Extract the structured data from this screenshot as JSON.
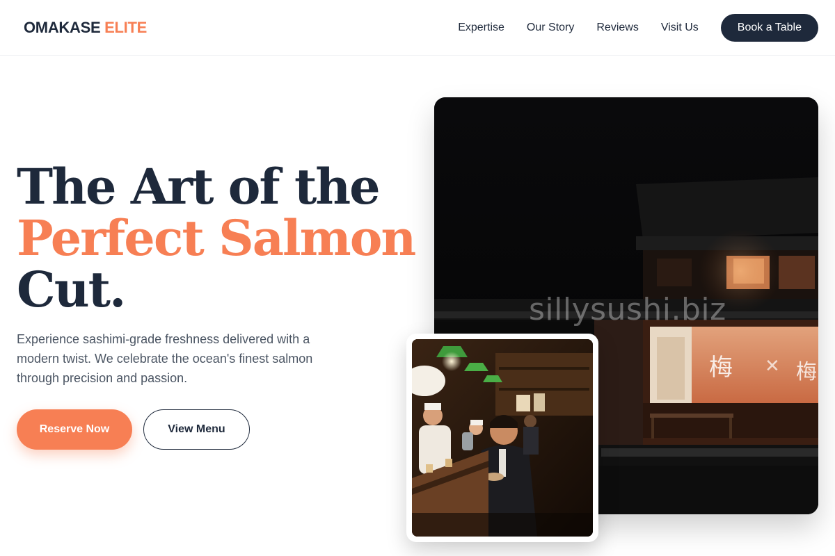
{
  "brand": {
    "part1": "OMAKASE",
    "part2": "ELITE"
  },
  "nav": {
    "items": [
      "Expertise",
      "Our Story",
      "Reviews",
      "Visit Us"
    ],
    "cta": "Book a Table"
  },
  "hero": {
    "title_line1": "The Art of the",
    "title_line2": "Perfect Salmon",
    "title_line3": "Cut.",
    "description": "Experience sashimi-grade freshness delivered with a modern twist. We celebrate the ocean's finest salmon through precision and passion.",
    "primary_button": "Reserve Now",
    "secondary_button": "View Menu"
  },
  "images": {
    "watermark": "sillysushi.biz"
  },
  "colors": {
    "navy": "#1e293b",
    "accent": "#f77f54"
  }
}
